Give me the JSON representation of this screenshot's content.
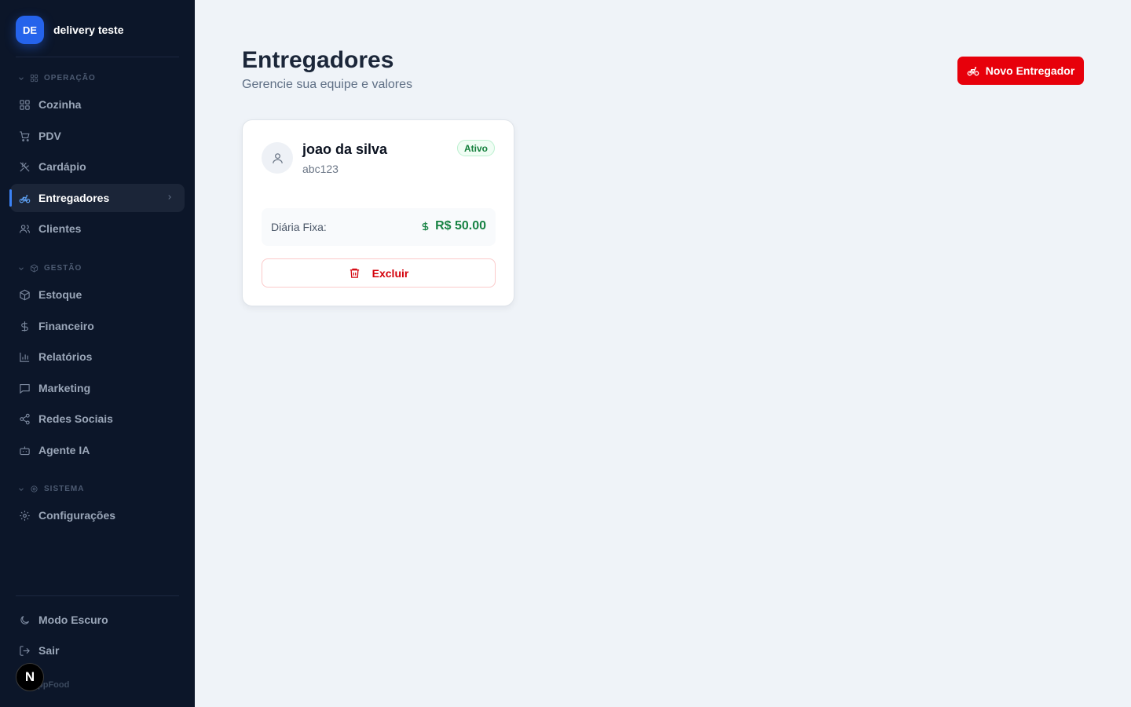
{
  "sidebar": {
    "brand": {
      "initials": "DE",
      "name": "delivery teste"
    },
    "sections": [
      {
        "label": "OPERAÇÃO"
      },
      {
        "label": "GESTÃO"
      },
      {
        "label": "SISTEMA"
      }
    ],
    "items": [
      {
        "label": "Cozinha",
        "icon": "grid-icon"
      },
      {
        "label": "PDV",
        "icon": "cart-icon"
      },
      {
        "label": "Cardápio",
        "icon": "utensils-icon"
      },
      {
        "label": "Entregadores",
        "icon": "bike-icon",
        "active": true
      },
      {
        "label": "Clientes",
        "icon": "users-icon"
      },
      {
        "label": "Estoque",
        "icon": "box-icon"
      },
      {
        "label": "Financeiro",
        "icon": "dollar-icon"
      },
      {
        "label": "Relatórios",
        "icon": "bar-chart-icon"
      },
      {
        "label": "Marketing",
        "icon": "message-icon"
      },
      {
        "label": "Redes Sociais",
        "icon": "share-icon"
      },
      {
        "label": "Agente IA",
        "icon": "bot-icon"
      },
      {
        "label": "Configurações",
        "icon": "gear-icon"
      }
    ],
    "footer": {
      "dark_mode": "Modo Escuro",
      "logout": "Sair",
      "app_name": "ppFood",
      "next_badge": "N"
    }
  },
  "header": {
    "title": "Entregadores",
    "subtitle": "Gerencie sua equipe e valores",
    "new_button": "Novo Entregador"
  },
  "couriers": [
    {
      "name": "joao da silva",
      "code": "abc123",
      "status": "Ativo",
      "fee_label": "Diária Fixa:",
      "fee_value": "R$ 50.00",
      "delete_label": "Excluir"
    }
  ],
  "colors": {
    "accent": "#e7000b",
    "sidebar_bg": "#0c1629",
    "active_indicator": "#3b82f6",
    "success": "#178243"
  }
}
